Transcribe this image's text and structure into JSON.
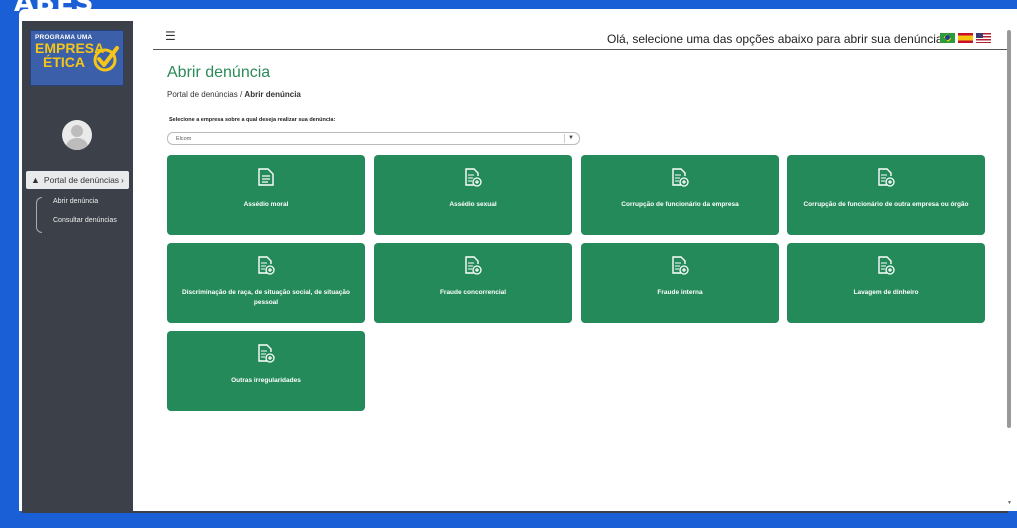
{
  "banner": {
    "text": "ABES"
  },
  "header": {
    "greeting": "Olá, selecione uma das opções abaixo para abrir sua denúncia",
    "flags": [
      "brazil-flag-icon",
      "spain-flag-icon",
      "usa-flag-icon"
    ]
  },
  "logo": {
    "line1": "PROGRAMA UMA",
    "line2": "EMPRESA",
    "line3": "ÉTICA"
  },
  "sidebar": {
    "portal_label": "Portal de denúncias",
    "items": [
      {
        "label": "Abrir denúncia"
      },
      {
        "label": "Consultar denúncias"
      }
    ]
  },
  "main": {
    "title": "Abrir denúncia",
    "breadcrumb": {
      "root": "Portal de denúncias",
      "separator": "/",
      "current": "Abrir denúncia"
    },
    "select_label": "Selecione a empresa sobre a qual deseja realizar sua denúncia:",
    "select_value": "Elcom",
    "cards": [
      {
        "label": "Assédio moral",
        "icon": "document-icon"
      },
      {
        "label": "Assédio sexual",
        "icon": "document-add-icon"
      },
      {
        "label": "Corrupção de funcionário da empresa",
        "icon": "document-add-icon"
      },
      {
        "label": "Corrupção de funcionário de outra empresa ou órgão",
        "icon": "document-add-icon"
      },
      {
        "label": "Discriminação de raça, de situação social, de situação pessoal",
        "icon": "document-add-icon"
      },
      {
        "label": "Fraude concorrencial",
        "icon": "document-add-icon"
      },
      {
        "label": "Fraude interna",
        "icon": "document-add-icon"
      },
      {
        "label": "Lavagem de dinheiro",
        "icon": "document-add-icon"
      },
      {
        "label": "Outras irregularidades",
        "icon": "document-add-icon"
      }
    ]
  },
  "colors": {
    "accent": "#258a59",
    "sidebar": "#3c4049",
    "frame": "#1a5fd6",
    "logo_blue": "#3b5fa8",
    "logo_yellow": "#f5c518"
  }
}
